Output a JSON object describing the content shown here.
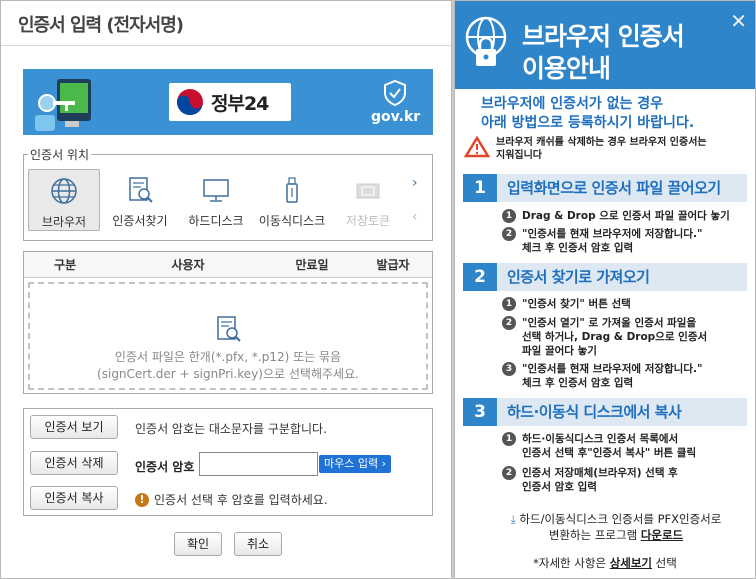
{
  "dialog": {
    "title": "인증서 입력 (전자서명)",
    "banner": {
      "logo_text": "정부24",
      "site": "gov.kr"
    },
    "location": {
      "label": "인증서 위치",
      "items": [
        {
          "label": "브라우저",
          "icon": "globe-icon",
          "state": "active"
        },
        {
          "label": "인증서찾기",
          "icon": "cert-search-icon",
          "state": "normal"
        },
        {
          "label": "하드디스크",
          "icon": "monitor-icon",
          "state": "normal"
        },
        {
          "label": "이동식디스크",
          "icon": "usb-icon",
          "state": "normal"
        },
        {
          "label": "저장토큰",
          "icon": "token-icon",
          "state": "disabled"
        }
      ]
    },
    "table": {
      "headers": [
        "구분",
        "사용자",
        "만료일",
        "발급자"
      ],
      "drop_text_1": "인증서 파일은 한개(*.pfx, *.p12) 또는 묶음",
      "drop_text_2": "(signCert.der + signPri.key)으로 선택해주세요."
    },
    "actions": {
      "view_label": "인증서 보기",
      "delete_label": "인증서 삭제",
      "copy_label": "인증서 복사",
      "case_hint": "인증서 암호는 대소문자를 구분합니다.",
      "password_label": "인증서 암호",
      "password_value": "",
      "mouse_input_label": "마우스 입력",
      "warning": "인증서 선택 후 암호를 입력하세요."
    },
    "confirm_label": "확인",
    "cancel_label": "취소"
  },
  "guide": {
    "title_line1": "브라우저 인증서",
    "title_line2": "이용안내",
    "lead_line1": "브라우저에 인증서가 없는 경우",
    "lead_line2": "아래 방법으로 등록하시기 바랍니다.",
    "alert_line1": "브라우저 캐쉬를 삭제하는 경우 브라우저 인증서는",
    "alert_line2": "지워집니다",
    "sections": [
      {
        "num": "1",
        "title": "입력화면으로 인증서 파일 끌어오기",
        "steps": [
          {
            "num": "1",
            "lines": [
              "Drag & Drop 으로 인증서 파일 끌어다 놓기"
            ]
          },
          {
            "num": "2",
            "lines": [
              "\"인증서를 현재 브라우저에 저장합니다.\"",
              "체크 후 인증서 암호 입력"
            ]
          }
        ]
      },
      {
        "num": "2",
        "title": "인증서 찾기로 가져오기",
        "steps": [
          {
            "num": "1",
            "lines": [
              "\"인증서 찾기\" 버튼 선택"
            ]
          },
          {
            "num": "2",
            "lines": [
              "\"인증서 열기\" 로 가져올 인증서 파일을",
              "선택 하거나, Drag & Drop으로 인증서",
              "파일 끌어다 놓기"
            ]
          },
          {
            "num": "3",
            "lines": [
              "\"인증서를 현재 브라우저에 저장합니다.\"",
              "체크 후 인증서 암호 입력"
            ]
          }
        ]
      },
      {
        "num": "3",
        "title": "하드·이동식 디스크에서 복사",
        "steps": [
          {
            "num": "1",
            "lines": [
              "하드·이동식디스크 인증서 목록에서",
              "인증서 선택 후\"인증서 복사\" 버튼 클릭"
            ]
          },
          {
            "num": "2",
            "lines": [
              "인증서 저장매체(브라우저) 선택 후",
              "인증서 암호 입력"
            ]
          }
        ]
      }
    ],
    "download_line1": "하드/이동식디스크 인증서를 PFX인증서로",
    "download_line2_prefix": "변환하는 프로그램 ",
    "download_link": "다운로드",
    "more_prefix": "*자세한 사항은 ",
    "more_link": "상세보기",
    "more_suffix": " 선택"
  }
}
